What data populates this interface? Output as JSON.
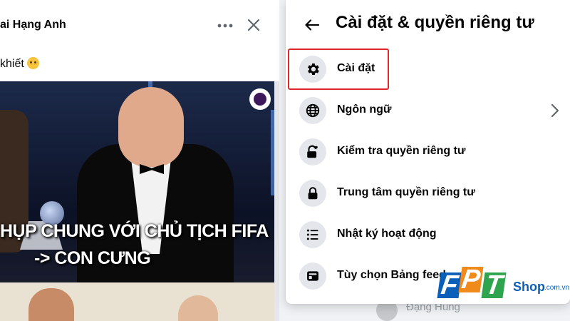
{
  "post": {
    "author": "ai Hạng Anh",
    "caption": "khiết",
    "image_text_line1": "HỤP CHUNG VỚI CHỦ TỊCH FIFA",
    "image_text_line2": "-> CON CƯNG"
  },
  "settings_panel": {
    "title": "Cài đặt & quyền riêng tư",
    "items": [
      {
        "label": "Cài đặt",
        "icon": "gear-icon",
        "has_chevron": false,
        "highlighted": true
      },
      {
        "label": "Ngôn ngữ",
        "icon": "globe-icon",
        "has_chevron": true,
        "highlighted": false
      },
      {
        "label": "Kiểm tra quyền riêng tư",
        "icon": "lock-heart-icon",
        "has_chevron": false,
        "highlighted": false
      },
      {
        "label": "Trung tâm quyền riêng tư",
        "icon": "lock-icon",
        "has_chevron": false,
        "highlighted": false
      },
      {
        "label": "Nhật ký hoạt động",
        "icon": "list-icon",
        "has_chevron": false,
        "highlighted": false
      },
      {
        "label": "Tùy chọn Bảng feed",
        "icon": "feed-icon",
        "has_chevron": false,
        "highlighted": false
      }
    ]
  },
  "footer": {
    "name": "Đặng Hùng"
  },
  "watermark": {
    "letters": [
      "F",
      "P",
      "T"
    ],
    "shop": "Shop",
    "domain": ".com.vn"
  },
  "colors": {
    "highlight_border": "#e0272d",
    "icon_bg": "#e4e6eb",
    "fpt_blue": "#0c5fb8",
    "fpt_orange": "#f08a1a",
    "fpt_green": "#2ea44f"
  }
}
